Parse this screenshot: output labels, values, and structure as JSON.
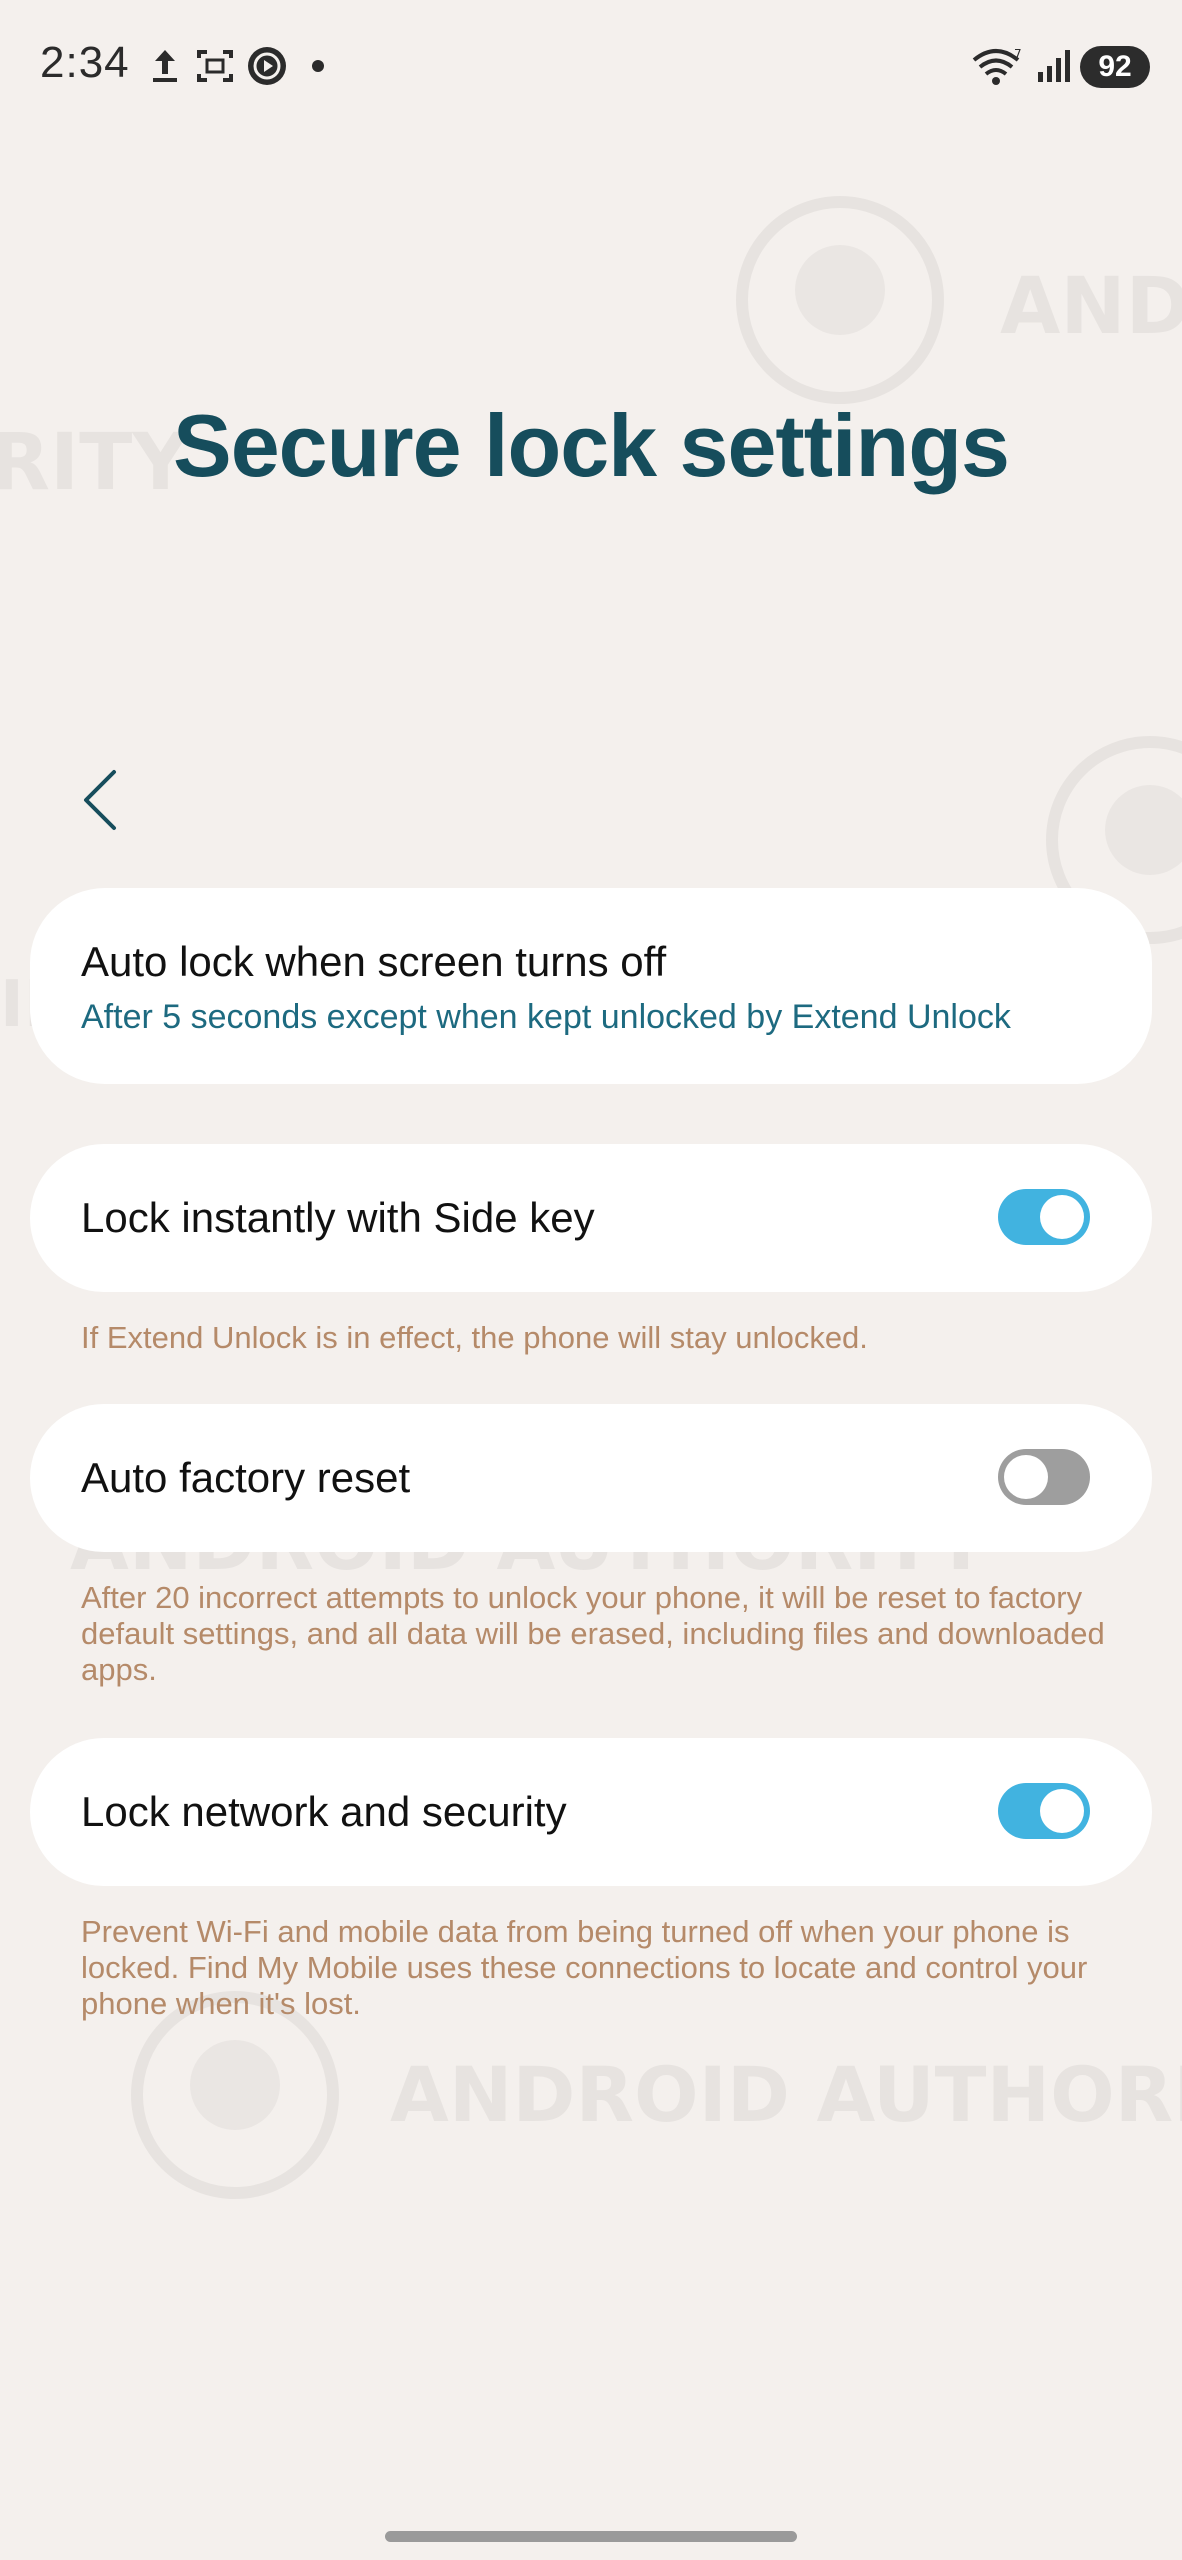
{
  "status_bar": {
    "time": "2:34",
    "battery": "92",
    "icons": [
      "upload-icon",
      "screenshot-icon",
      "play-circle-icon",
      "notification-dot-icon",
      "wifi-icon",
      "signal-icon"
    ]
  },
  "header": {
    "title": "Secure lock settings",
    "back_icon": "chevron-left-icon"
  },
  "settings": [
    {
      "title": "Auto lock when screen turns off",
      "subtitle": "After 5 seconds except when kept unlocked by Extend Unlock"
    },
    {
      "title": "Lock instantly with Side key",
      "toggle": true,
      "description": "If Extend Unlock is in effect, the phone will stay unlocked."
    },
    {
      "title": "Auto factory reset",
      "toggle": false,
      "description": "After 20 incorrect attempts to unlock your phone, it will be reset to factory default settings, and all data will be erased, including files and downloaded apps."
    },
    {
      "title": "Lock network and security",
      "toggle": true,
      "description": "Prevent Wi-Fi and mobile data from being turned off when your phone is locked. Find My Mobile uses these connections to locate and control your phone when it's lost."
    }
  ],
  "colors": {
    "background": "#f4f0ed",
    "title": "#164d5c",
    "accent": "#41b3e0",
    "subtitle": "#1d6a80",
    "description": "#b58a69"
  }
}
